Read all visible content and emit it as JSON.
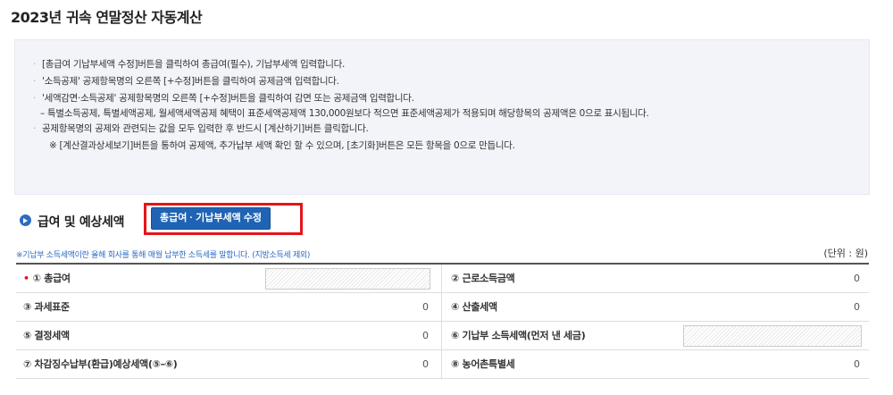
{
  "page_title": "2023년 귀속 연말정산 자동계산",
  "guide": {
    "line1": "[총급여 기납부세액 수정]버튼을 클릭하여 총급여(필수), 기납부세액 입력합니다.",
    "line2": "'소득공제' 공제항목명의 오른쪽 [+수정]버튼을 클릭하여 공제금액 입력합니다.",
    "line3": "'세액감면·소득공제' 공제항목명의 오른쪽 [+수정]버튼을 클릭하여 감면 또는 공제금액 입력합니다.",
    "line3_sub": "– 특별소득공제, 특별세액공제, 월세액세액공제 혜택이 표준세액공제액 130,000원보다 적으면 표준세액공제가 적용되며 해당항목의 공제액은 0으로 표시됩니다.",
    "line4": "공제항목명의 공제와 관련되는 값을 모두 입력한 후 반드시 [계산하기]버튼 클릭합니다.",
    "line4_note": "※ [계산결과상세보기]버튼을 통하여 공제액, 추가납부 세액 확인 할 수 있으며, [초기화]버튼은 모든 항목을 0으로 만듭니다."
  },
  "section": {
    "title": "급여 및 예상세액",
    "edit_button": "총급여 · 기납부세액 수정"
  },
  "footnote": "※기납부 소득세액이란 올해 회사를 통해 매월 납부한 소득세를 말합니다. (지방소득세 제외)",
  "unit": "(단위 : 원)",
  "rows": [
    {
      "l_label": "① 총급여",
      "l_required": "•",
      "r_label": "② 근로소득금액",
      "r_value": "0"
    },
    {
      "l_label": "③ 과세표준",
      "l_value": "0",
      "r_label": "④ 산출세액",
      "r_value": "0"
    },
    {
      "l_label": "⑤ 결정세액",
      "l_value": "0",
      "r_label": "⑥ 기납부 소득세액(먼저 낸 세금)"
    },
    {
      "l_label": "⑦ 차감징수납부(환급)예상세액(⑤–⑥)",
      "l_value": "0",
      "r_label": "⑧ 농어촌특별세",
      "r_value": "0"
    }
  ],
  "colors": {
    "accent_blue": "#1f64b4",
    "highlight_red": "#e4151c",
    "guide_bg": "#f2f4f9"
  },
  "icons": {
    "section_bullet": "circle-arrow-right-icon"
  }
}
